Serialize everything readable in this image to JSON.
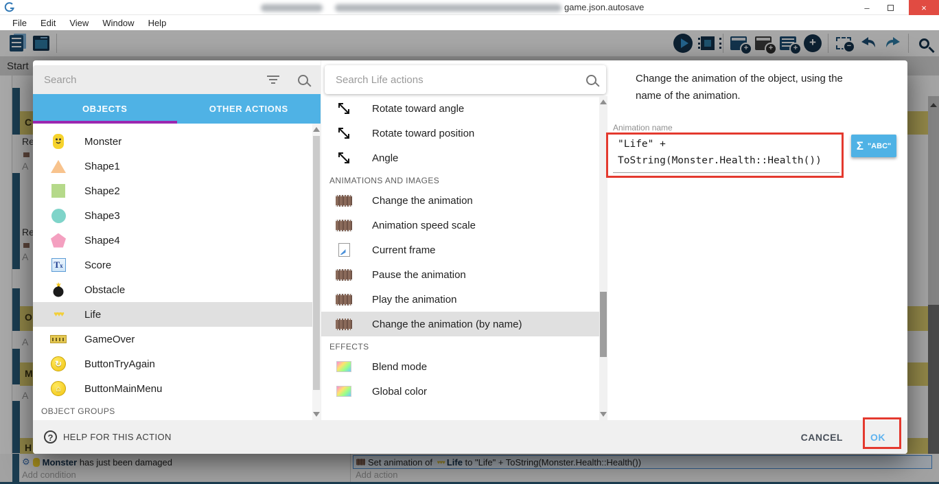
{
  "window": {
    "title": "game.json.autosave",
    "controls": {
      "minimize": "–",
      "close": "×"
    }
  },
  "menu": {
    "items": [
      "File",
      "Edit",
      "View",
      "Window",
      "Help"
    ]
  },
  "toolbar": {
    "left_icons": [
      {
        "name": "events-sheet"
      },
      {
        "name": "scene-editor"
      }
    ],
    "right_icons": [
      {
        "name": "play"
      },
      {
        "name": "debug"
      },
      {
        "name": "add-event"
      },
      {
        "name": "add-comment"
      },
      {
        "name": "add-subevent"
      },
      {
        "name": "add-new"
      },
      {
        "name": "remove-selection"
      },
      {
        "name": "undo"
      },
      {
        "name": "redo"
      },
      {
        "name": "search"
      }
    ]
  },
  "background": {
    "tab_label": "Start",
    "fragments": [
      {
        "text": "C"
      },
      {
        "text": "Re"
      },
      {
        "text": "A"
      },
      {
        "text": "Re"
      },
      {
        "text": "A"
      },
      {
        "text": "O"
      },
      {
        "text": "A"
      },
      {
        "text": "M"
      },
      {
        "text": "A"
      },
      {
        "text": "H"
      }
    ],
    "bottom_event": {
      "condition_object": "Monster",
      "condition_text": " has just been damaged",
      "add_condition": "Add condition",
      "action_prefix": "Set animation of ",
      "hearts": "♥♥♥",
      "action_object": "Life",
      "action_infix": " to ",
      "action_expression": "\"Life\" + ToString(Monster.Health::Health())",
      "add_action": "Add action"
    }
  },
  "dialog": {
    "left": {
      "search_placeholder": "Search",
      "tabs": [
        {
          "label": "OBJECTS"
        },
        {
          "label": "OTHER ACTIONS"
        }
      ],
      "objects": [
        {
          "name": "Monster"
        },
        {
          "name": "Shape1"
        },
        {
          "name": "Shape2"
        },
        {
          "name": "Shape3"
        },
        {
          "name": "Shape4"
        },
        {
          "name": "Score"
        },
        {
          "name": "Obstacle"
        },
        {
          "name": "Life"
        },
        {
          "name": "GameOver"
        },
        {
          "name": "ButtonTryAgain"
        },
        {
          "name": "ButtonMainMenu"
        }
      ],
      "selected_object": "Life",
      "groups_header": "OBJECT GROUPS"
    },
    "middle": {
      "search_placeholder": "Search Life actions",
      "rotation_items": [
        {
          "label": "Rotate toward angle"
        },
        {
          "label": "Rotate toward position"
        },
        {
          "label": "Angle"
        }
      ],
      "animations_header": "ANIMATIONS AND IMAGES",
      "animation_items": [
        {
          "label": "Change the animation"
        },
        {
          "label": "Animation speed scale"
        },
        {
          "label": "Current frame"
        },
        {
          "label": "Pause the animation"
        },
        {
          "label": "Play the animation"
        },
        {
          "label": "Change the animation (by name)"
        }
      ],
      "selected_action": "Change the animation (by name)",
      "effects_header": "EFFECTS",
      "effect_items": [
        {
          "label": "Blend mode"
        },
        {
          "label": "Global color"
        }
      ]
    },
    "right": {
      "description": "Change the animation of the object, using the name of the animation.",
      "field_label": "Animation name",
      "field_line1": "\"Life\" +",
      "field_line2": "ToString(Monster.Health::Health())",
      "expression_button_sigma": "Σ",
      "expression_button_label": "\"ABC\""
    },
    "footer": {
      "help": "HELP FOR THIS ACTION",
      "cancel": "CANCEL",
      "ok": "OK"
    }
  },
  "colors": {
    "tab_blue": "#4fb2e5",
    "tab_underline_purple": "#9c27b0",
    "annotation_red": "#e4392e",
    "selection_gray": "#e0e0e0",
    "expression_button_blue": "#4fb2e5",
    "ok_blue": "#5fb3ef",
    "close_red": "#e14b42"
  }
}
